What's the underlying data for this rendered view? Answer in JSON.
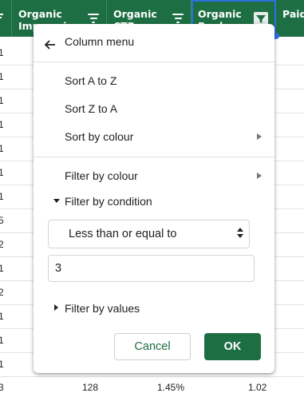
{
  "header": {
    "col1_label": "Organic Impressions",
    "col2_label": "Organic CTR",
    "col3_label": "Organic Rank",
    "col4_label": "Paid Share"
  },
  "rows": {
    "values": [
      "1",
      "1",
      "1",
      "1",
      "1",
      "1",
      "1",
      "5",
      "2",
      "1",
      "2",
      "1",
      "1",
      "1"
    ],
    "bottom": [
      "3",
      "128",
      "1.45%",
      "1.02"
    ]
  },
  "menu": {
    "title": "Column menu",
    "sort_az": "Sort A to Z",
    "sort_za": "Sort Z to A",
    "sort_colour": "Sort by colour",
    "filter_colour": "Filter by colour",
    "filter_condition": "Filter by condition",
    "condition_selected": "Less than or equal to",
    "condition_value": "3",
    "filter_values": "Filter by values",
    "cancel": "Cancel",
    "ok": "OK"
  },
  "colors": {
    "header_green": "#1e6e43",
    "accent_blue": "#2b6fe0"
  },
  "icons": [
    "back-arrow-icon",
    "submenu-arrow-icon",
    "triangle-down-icon",
    "triangle-right-icon",
    "filter-lines-icon",
    "funnel-icon",
    "updown-arrows-icon"
  ]
}
